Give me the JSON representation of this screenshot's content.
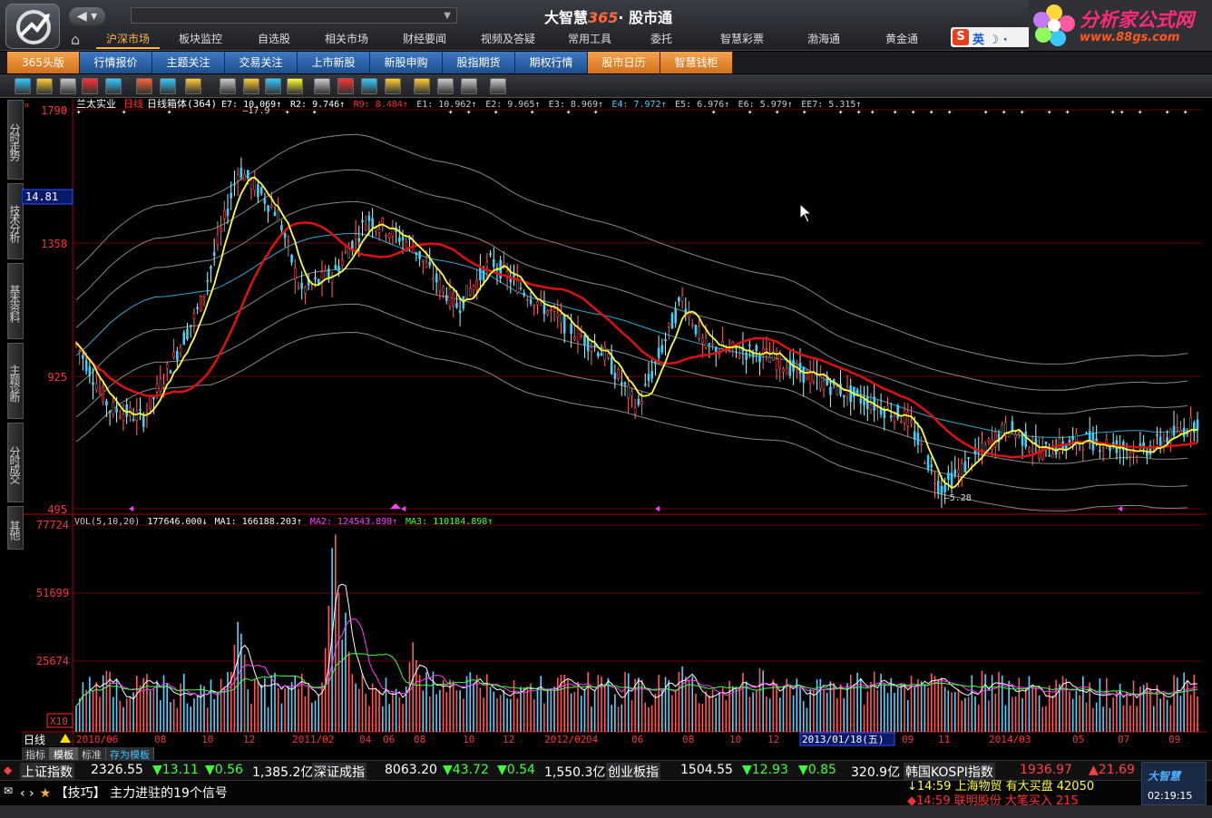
{
  "app": {
    "title_prefix": "大智慧",
    "title_accent": "365",
    "title_suffix": "· 股市通",
    "back_label": "◀ ▾"
  },
  "menu": [
    {
      "label": "沪深市场",
      "active": true
    },
    {
      "label": "板块监控",
      "active": false
    },
    {
      "label": "自选股",
      "active": false
    },
    {
      "label": "相关市场",
      "active": false
    },
    {
      "label": "财经要闻",
      "active": false
    },
    {
      "label": "视频及答疑",
      "active": false
    },
    {
      "label": "常用工具",
      "active": false
    },
    {
      "label": "委托",
      "active": false
    },
    {
      "label": "智慧彩票",
      "active": false
    },
    {
      "label": "渤海通",
      "active": false
    },
    {
      "label": "黄金通",
      "active": false
    }
  ],
  "ime": {
    "s": "S",
    "text": "英 ☽ ·"
  },
  "watermark": {
    "line1": "分析家公式网",
    "line2": "www.88gs.com"
  },
  "tabs2": [
    {
      "label": "365头版",
      "style": "orange"
    },
    {
      "label": "行情报价",
      "style": "blue"
    },
    {
      "label": "主题关注",
      "style": "blue"
    },
    {
      "label": "交易关注",
      "style": "blue"
    },
    {
      "label": "上市新股",
      "style": "blue"
    },
    {
      "label": "新股申购",
      "style": "blue"
    },
    {
      "label": "股指期货",
      "style": "blue"
    },
    {
      "label": "期权行情",
      "style": "blue"
    },
    {
      "label": "股市日历",
      "style": "orange"
    },
    {
      "label": "智慧钱柜",
      "style": "orange"
    }
  ],
  "toolbar_icons": [
    "k-line-icon",
    "chart-icon",
    "grid-icon",
    "rsi-icon",
    "compare-icon",
    "down-arrow-icon",
    "cursor-icon",
    "draw-line-icon",
    "zoom-icon",
    "alarm-icon",
    "text-icon",
    "info-icon",
    "indicator-icon",
    "bar-chart-icon",
    "stat-icon",
    "line-icon",
    "boll-icon",
    "triangle-icon",
    "note-icon",
    "print-icon",
    "export-icon",
    "help-icon"
  ],
  "side_tabs": [
    "分时走势",
    "技术分析",
    "基本资料",
    "主题诊断",
    "分时成交",
    "其他"
  ],
  "chart": {
    "stock_name": "兰太实业",
    "period": "日线",
    "indicator": "日线箱体",
    "count": "(364)",
    "params": [
      {
        "text": "E7: 10.069",
        "color": "#ffffff"
      },
      {
        "text": "R2: 9.746",
        "color": "#ffffff"
      },
      {
        "text": "R9: 8.484",
        "color": "#ff3030"
      },
      {
        "text": "E1: 10.962",
        "color": "#cccccc"
      },
      {
        "text": "E2: 9.965",
        "color": "#cccccc"
      },
      {
        "text": "E3: 8.969",
        "color": "#cccccc"
      },
      {
        "text": "E4: 7.972",
        "color": "#3cd2ff"
      },
      {
        "text": "E5: 6.976",
        "color": "#cccccc"
      },
      {
        "text": "E6: 5.979",
        "color": "#cccccc"
      },
      {
        "text": "EE7: 5.315",
        "color": "#cccccc"
      }
    ],
    "y_labels": [
      "1790",
      "1358",
      "925",
      "495"
    ],
    "cursor_price": "14.81",
    "high_mark": "17.9",
    "low_mark": "5.28",
    "vol_header": [
      {
        "text": "VOL(5,10,20)",
        "color": "#cccccc"
      },
      {
        "text": "177646.000↓",
        "color": "#ffffff"
      },
      {
        "text": "MA1: 166188.203↑",
        "color": "#ffffff"
      },
      {
        "text": "MA2: 124543.898↑",
        "color": "#ff3cff"
      },
      {
        "text": "MA3: 110184.898↑",
        "color": "#3cff3c"
      }
    ],
    "vol_y_labels": [
      "77724",
      "51699",
      "25674"
    ],
    "vol_unit": "X10",
    "period_label": "日线",
    "x_labels": [
      "2010/06",
      "08",
      "10",
      "12",
      "2011/02",
      "04",
      "06",
      "08",
      "10",
      "12",
      "2012/02",
      "04",
      "06",
      "08",
      "10",
      "12",
      "2013/01/18(五)",
      "09",
      "11",
      "2014/03",
      "05",
      "07",
      "09"
    ]
  },
  "index_tabs": [
    {
      "label": "指标",
      "sel": false
    },
    {
      "label": "模板",
      "sel": true
    },
    {
      "label": "标准",
      "sel": false
    },
    {
      "label": "存为模板",
      "sel": false,
      "link": true
    }
  ],
  "ticker": {
    "sh_name": "上证指数",
    "sh_val": "2326.55",
    "sh_chg": "▼13.11",
    "sh_pct": "▼0.56",
    "sh_amt": "1,385.2亿",
    "sz_name": "深证成指",
    "sz_val": "8063.20",
    "sz_chg": "▼43.72",
    "sz_pct": "▼0.54",
    "sz_amt": "1,550.3亿",
    "cy_name": "创业板指",
    "cy_val": "1504.55",
    "cy_chg": "▼12.93",
    "cy_pct": "▼0.85",
    "cy_amt": "320.9亿",
    "kr_name": "韩国KOSPI指数",
    "kr_val": "1936.97",
    "kr_chg": "▲21.69"
  },
  "tips": {
    "arrows": "‹ ›",
    "star": "★",
    "text": "【技巧】 主力进驻的19个信号"
  },
  "news": [
    {
      "text": "↓14:59 上海物贸 有大买盘 42050",
      "color": "#ffff3c"
    },
    {
      "text": "◆14:59 联明股份 大笔买入 215",
      "color": "#ff3030"
    }
  ],
  "brand": {
    "name": "大智慧",
    "time": "02:19:15"
  }
}
